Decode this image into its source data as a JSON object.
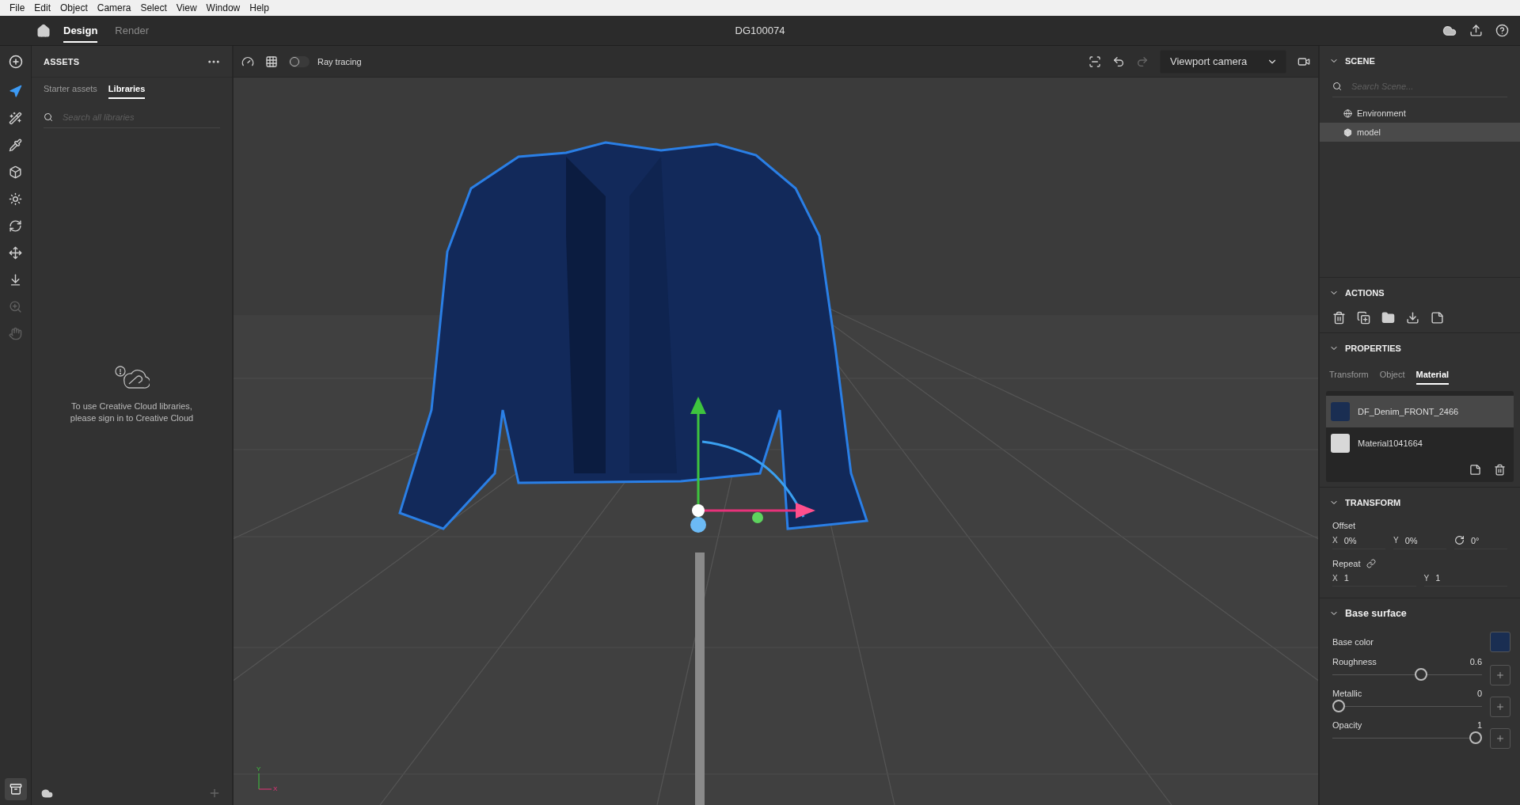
{
  "menu_bar": [
    "File",
    "Edit",
    "Object",
    "Camera",
    "Select",
    "View",
    "Window",
    "Help"
  ],
  "app_bar": {
    "tabs": [
      {
        "label": "Design",
        "selected": true
      },
      {
        "label": "Render",
        "selected": false
      }
    ],
    "document_title": "DG100074"
  },
  "tool_strip": {
    "tools": [
      {
        "kind": "select",
        "selected": true,
        "disabled": false
      },
      {
        "kind": "magic",
        "selected": false,
        "disabled": false
      },
      {
        "kind": "eyedropper",
        "selected": false,
        "disabled": false
      },
      {
        "kind": "cube",
        "selected": false,
        "disabled": false
      },
      {
        "kind": "light",
        "selected": false,
        "disabled": false
      },
      {
        "kind": "orbit",
        "selected": false,
        "disabled": false
      },
      {
        "kind": "move",
        "selected": false,
        "disabled": false
      },
      {
        "kind": "drop",
        "selected": false,
        "disabled": false
      },
      {
        "kind": "zoom",
        "selected": false,
        "disabled": true
      },
      {
        "kind": "hand",
        "selected": false,
        "disabled": true
      }
    ]
  },
  "assets": {
    "title": "ASSETS",
    "tabs": [
      {
        "label": "Starter assets",
        "selected": false
      },
      {
        "label": "Libraries",
        "selected": true
      }
    ],
    "search": {
      "placeholder": "Search all libraries"
    },
    "message": "To use Creative Cloud libraries, please sign in to Creative Cloud"
  },
  "viewport": {
    "ray_tracing": {
      "label": "Ray tracing",
      "on": false
    },
    "camera": "Viewport camera",
    "axis_labels": [
      "Y",
      "X"
    ]
  },
  "scene": {
    "title": "SCENE",
    "search": {
      "placeholder": "Search Scene..."
    },
    "items": [
      {
        "kind": "environment",
        "label": "Environment",
        "selected": false
      },
      {
        "kind": "model",
        "label": "model",
        "selected": true
      }
    ]
  },
  "actions": {
    "title": "ACTIONS"
  },
  "properties": {
    "title": "PROPERTIES",
    "tabs": [
      {
        "label": "Transform",
        "selected": false
      },
      {
        "label": "Object",
        "selected": false
      },
      {
        "label": "Material",
        "selected": true
      }
    ],
    "materials": [
      {
        "name": "DF_Denim_FRONT_2466",
        "kind": "texture",
        "selected": true
      },
      {
        "name": "Material1041664",
        "kind": "plain",
        "selected": false
      }
    ]
  },
  "transform": {
    "title": "TRANSFORM",
    "offset": {
      "label": "Offset",
      "fields": [
        {
          "label": "X",
          "value": "0%"
        },
        {
          "label": "Y",
          "value": "0%"
        },
        {
          "kind": "rotation",
          "value": "0°"
        }
      ]
    },
    "repeat": {
      "label": "Repeat",
      "fields": [
        {
          "label": "X",
          "value": "1"
        },
        {
          "label": "Y",
          "value": "1"
        }
      ]
    }
  },
  "base_surface": {
    "title": "Base surface",
    "base_color": {
      "label": "Base color"
    },
    "sliders": [
      {
        "label": "Roughness",
        "value": "0.6",
        "level": 0.6
      },
      {
        "label": "Metallic",
        "value": "0",
        "level": 0
      },
      {
        "label": "Opacity",
        "value": "1",
        "level": 1
      }
    ]
  }
}
